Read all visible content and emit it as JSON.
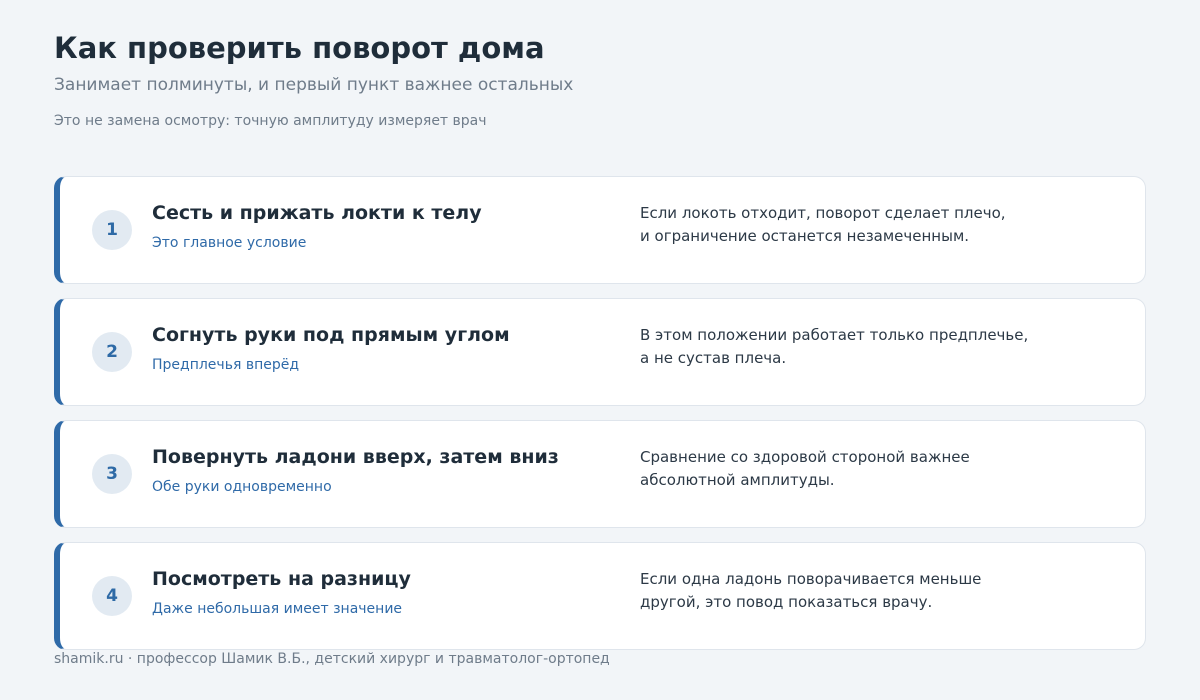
{
  "header": {
    "title": "Как проверить поворот дома",
    "subtitle": "Занимает полминуты, и первый пункт важнее остальных",
    "note": "Это не замена осмотру: точную амплитуду измеряет врач"
  },
  "steps": [
    {
      "number": "1",
      "title": "Сесть и прижать локти к телу",
      "hint": "Это главное условие",
      "description_lines": [
        "Если локоть отходит, поворот сделает плечо,",
        "и ограничение останется незамеченным."
      ]
    },
    {
      "number": "2",
      "title": "Согнуть руки под прямым углом",
      "hint": "Предплечья вперёд",
      "description_lines": [
        "В этом положении работает только предплечье,",
        "а не сустав плеча."
      ]
    },
    {
      "number": "3",
      "title": "Повернуть ладони вверх, затем вниз",
      "hint": "Обе руки одновременно",
      "description_lines": [
        "Сравнение со здоровой стороной важнее",
        "абсолютной амплитуды."
      ]
    },
    {
      "number": "4",
      "title": "Посмотреть на разницу",
      "hint": "Даже небольшая имеет значение",
      "description_lines": [
        "Если одна ладонь поворачивается меньше",
        "другой, это повод показаться врачу."
      ]
    }
  ],
  "footer": {
    "text": "shamik.ru · профессор Шамик В.Б., детский хирург и травматолог-ортопед"
  },
  "colors": {
    "accent": "#2f6aa8",
    "background": "#f2f5f8",
    "card": "#ffffff"
  }
}
